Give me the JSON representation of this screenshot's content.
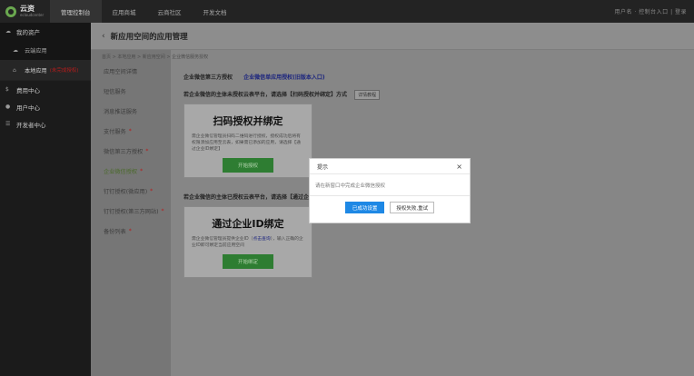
{
  "topbar": {
    "logo_main": "云资",
    "logo_sub": "ecloudcenter",
    "nav": [
      "管理控制台",
      "应用商城",
      "云商社区",
      "开发文档"
    ],
    "right_text": "用户名 · 控制台入口 | 登录"
  },
  "sidebar": {
    "groups": [
      {
        "label": "我的资产",
        "icon": "cloud"
      },
      {
        "label": "费用中心",
        "icon": "dollar"
      },
      {
        "label": "用户中心",
        "icon": "user"
      },
      {
        "label": "开发者中心",
        "icon": "list"
      }
    ],
    "subs": [
      {
        "label": "云端应用",
        "icon": "cloud"
      },
      {
        "label": "本地应用",
        "icon": "home",
        "badge": "(未完成授权)"
      }
    ]
  },
  "page": {
    "back_icon": "‹",
    "title": "新应用空间的应用管理",
    "breadcrumb": "首页 > 本地应用 > 新应用空间 > 企业微信服务授权"
  },
  "subside": {
    "items": [
      {
        "label": "应用空间详情",
        "star": ""
      },
      {
        "label": "短信服务",
        "star": ""
      },
      {
        "label": "消息推送服务",
        "star": ""
      },
      {
        "label": "支付服务",
        "star": "*"
      },
      {
        "label": "微信第三方授权",
        "star": "*"
      },
      {
        "label": "企业微信授权",
        "star": "*"
      },
      {
        "label": "钉钉授权(微应用)",
        "star": "*"
      },
      {
        "label": "钉钉授权(第三方网站)",
        "star": "*"
      },
      {
        "label": "备份列表",
        "star": "*"
      }
    ]
  },
  "main": {
    "section_title": "企业微信第三方授权",
    "section_link": "企业微信单应用授权(旧版本入口)",
    "notice1": "若企业微信的主体未授权云表平台，请选择【扫码授权并绑定】方式",
    "detail_btn": "详情教程",
    "card1": {
      "title": "扫码授权并绑定",
      "desc": "需企业微信管理员扫码二维码进行授权，授权成功后将有权限添加应用至云表，如果需已添加的应用，请选择【通过企业ID绑定】",
      "button": "开始授权"
    },
    "notice2": "若企业微信的主体已授权云表平台，请选择【通过企业ID绑定】方式",
    "card2": {
      "title": "通过企业ID绑定",
      "desc_a": "需企业微信管理员提供企业ID（",
      "desc_link": "点击查询",
      "desc_b": "），输入正确的企业ID即可绑定当前应用空间",
      "button": "开始绑定"
    }
  },
  "modal": {
    "title": "提示",
    "message": "请在新窗口中完成企业微信授权",
    "primary": "已成功设置",
    "secondary": "授权失败,重试",
    "close": "×"
  }
}
